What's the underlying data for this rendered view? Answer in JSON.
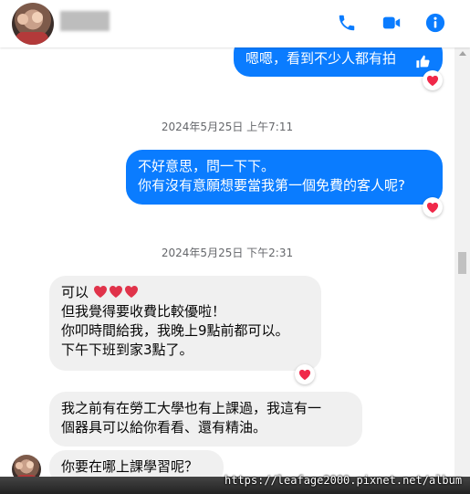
{
  "header": {
    "contact_name": "",
    "icons": [
      "phone-icon",
      "video-camera-icon",
      "info-icon"
    ],
    "accent_color": "#0a7cff"
  },
  "messages": [
    {
      "direction": "out",
      "lines": [
        "嗯嗯，看到不少人都有拍"
      ],
      "reaction": "heart",
      "icon": "like-icon"
    },
    {
      "type": "timestamp",
      "text": "2024年5月25日 上午7:11"
    },
    {
      "direction": "out",
      "lines": [
        "不好意思，問一下下。",
        "你有沒有意願想要當我第一個免費的客人呢?"
      ],
      "reaction": "heart"
    },
    {
      "type": "timestamp",
      "text": "2024年5月25日 下午2:31"
    },
    {
      "direction": "in",
      "lines": [
        "可以",
        "但我覺得要收費比較優啦！",
        "你叩時間給我，我晚上9點前都可以。",
        "下午下班到家3點了。"
      ],
      "emoji": "heart-emoji x3",
      "reaction": "heart"
    },
    {
      "direction": "in",
      "lines": [
        "我之前有在勞工大學也有上課過，我這有一",
        "個器具可以給你看看、還有精油。"
      ]
    },
    {
      "direction": "in",
      "lines": [
        "你要在哪上課學習呢？"
      ]
    }
  ],
  "watermark": "https://leafage2000.pixnet.net/album"
}
